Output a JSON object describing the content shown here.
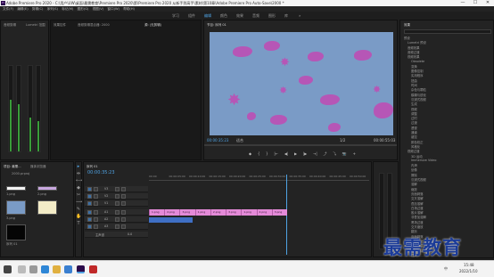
{
  "window": {
    "title": "Adobe Premiere Pro 2020 - C:\\用户\\UW\\桌面\\最需教育\\Premiere Pro 2020\\第\\Premiere Pro 2020 从新手到高手\\素材\\第10章\\Adobe Premiere Pro Auto-Save\\2000 *",
    "app_badge": "Pr",
    "minimize": "—",
    "maximize": "☐",
    "close": "✕"
  },
  "menu": [
    "文件(F)",
    "编辑(E)",
    "剪辑(C)",
    "序列(S)",
    "标记(M)",
    "图形(G)",
    "视图(V)",
    "窗口(W)",
    "帮助(H)"
  ],
  "workspaces": [
    "学习",
    "组件",
    "编辑",
    "颜色",
    "效果",
    "音频",
    "图形",
    "库",
    "»"
  ],
  "audio_meters": {
    "title": "音频剪辑",
    "tab2": "Lumetri 范围"
  },
  "source": {
    "tabs": [
      "效果控件",
      "音频剪辑混合器: 2000",
      "源: (无剪辑)"
    ]
  },
  "program": {
    "tab": "节目: 序列 01",
    "timecode": "00:00:35:23",
    "fit": "适合",
    "ratio": "1/2",
    "duration": "00:00:55:03",
    "controls": [
      "◆",
      "{",
      "}",
      "|←",
      "◀|",
      "▶",
      "|▶",
      "→|",
      "⤴",
      "⤵",
      "📷",
      "+"
    ]
  },
  "effects": {
    "title": "效果",
    "items": [
      "预设",
      "Lumetri 预设",
      "音频效果",
      "音频过渡",
      "视频效果",
      "Obsolete",
      "变换",
      "图像控制",
      "实用程序",
      "扭曲",
      "时间",
      "杂色与颗粒",
      "模糊与锐化",
      "沉浸式视频",
      "生成",
      "视频",
      "调整",
      "过时",
      "过渡",
      "透视",
      "通道",
      "键控",
      "颜色校正",
      "风格化",
      "视频过渡",
      "3D 运动",
      "Immersive Video",
      "内滑",
      "划像",
      "擦除",
      "沉浸式视频",
      "溶解",
      "缩放",
      "页面剥落",
      "交叉溶解",
      "叠加溶解",
      "白场过渡",
      "胶片溶解",
      "非叠加溶解",
      "黑场过渡",
      "交叉缩放",
      "翻页",
      "页面剥落",
      "中心拆分",
      "带状擦除",
      "径向擦除",
      "插入"
    ]
  },
  "project": {
    "tabs": [
      "项目: 最需...",
      "媒体浏览器"
    ],
    "file": "2000.prproj",
    "items": [
      "1.png",
      "2.png",
      "3.png",
      "序列 01"
    ]
  },
  "tools": [
    "▸",
    "⇼",
    "⟷",
    "◆",
    "✂",
    "⟿",
    "✎",
    "✋",
    "T"
  ],
  "timeline": {
    "tab": "序列 01",
    "timecode": "00:00:35:23",
    "ruler": [
      "00:00",
      "00:00:05:00",
      "00:00:10:00",
      "00:00:15:00",
      "00:00:20:00",
      "00:00:25:00",
      "00:00:30:00",
      "00:00:35:00",
      "00:00:40:00",
      "00:00:45:00",
      "00:00:50:00"
    ],
    "tracks": [
      "V3",
      "V2",
      "V1",
      "A1",
      "A2",
      "A3",
      "主声道"
    ],
    "master_value": "0.0",
    "clips": [
      "1.png",
      "2.png",
      "3.png",
      "1.png",
      "2.png",
      "3.png",
      "1.png",
      "2.png",
      "3.png"
    ]
  },
  "taskbar": {
    "time": "15:48",
    "date": "2022/1/10",
    "lang": "中"
  },
  "watermark": "最需教育",
  "colors": {
    "premiere_bg": "#232323",
    "video_bg": "#7a9bc6",
    "shape": "#b656b6",
    "clip": "#e48ad8",
    "audio_clip": "#3f6fc4",
    "watermark": "#1b3b98"
  }
}
